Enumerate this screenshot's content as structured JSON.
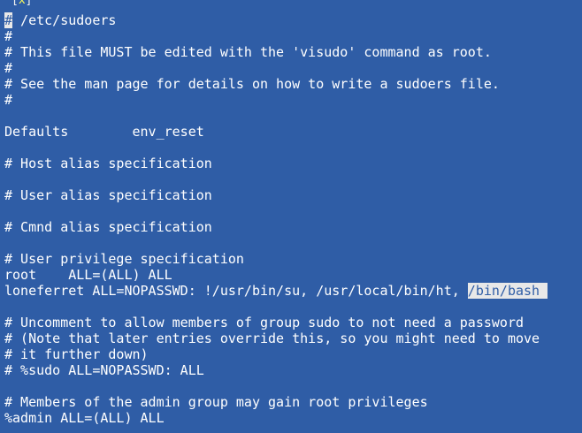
{
  "window": {
    "close_left": "[",
    "close_icon": "x",
    "close_right": "]"
  },
  "editor": {
    "cursor_char": "#",
    "first_line_rest": " /etc/sudoers",
    "lines": [
      "#",
      "# This file MUST be edited with the 'visudo' command as root.",
      "#",
      "# See the man page for details on how to write a sudoers file.",
      "#",
      "",
      "Defaults        env_reset",
      "",
      "# Host alias specification",
      "",
      "# User alias specification",
      "",
      "# Cmnd alias specification",
      "",
      "# User privilege specification",
      "root    ALL=(ALL) ALL"
    ],
    "selection_line": {
      "before": "loneferret ALL=NOPASSWD: !/usr/bin/su, /usr/local/bin/ht, ",
      "selected": "/bin/bash"
    },
    "lines_after": [
      "",
      "# Uncomment to allow members of group sudo to not need a password",
      "# (Note that later entries override this, so you might need to move",
      "# it further down)",
      "# %sudo ALL=NOPASSWD: ALL",
      "",
      "# Members of the admin group may gain root privileges",
      "%admin ALL=(ALL) ALL"
    ]
  }
}
